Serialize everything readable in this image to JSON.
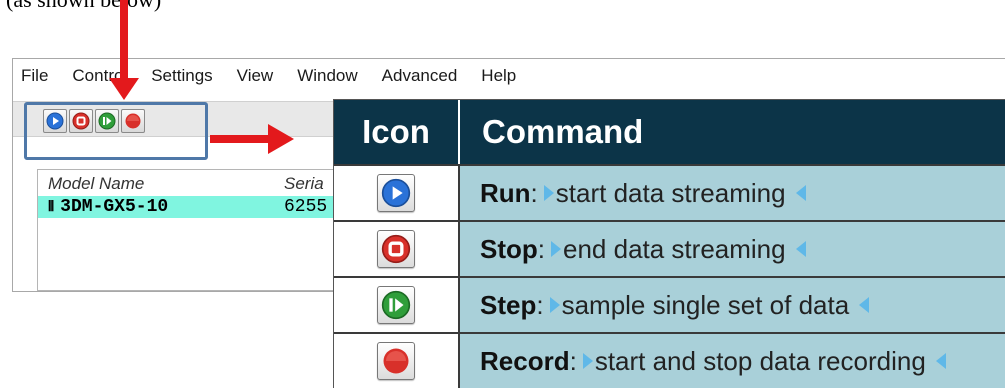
{
  "caption": "(as shown below)",
  "menu": [
    "File",
    "Control",
    "Settings",
    "View",
    "Window",
    "Advanced",
    "Help"
  ],
  "toolbar": {
    "buttons": [
      {
        "name": "run",
        "icon": "play-icon",
        "color": "#2a72d8"
      },
      {
        "name": "stop",
        "icon": "stop-icon",
        "color": "#d8302a"
      },
      {
        "name": "step",
        "icon": "step-icon",
        "color": "#2f9e3a"
      },
      {
        "name": "record",
        "icon": "record-icon",
        "color": "#d8302a"
      }
    ]
  },
  "device_list": {
    "columns": [
      "Model Name",
      "Seria"
    ],
    "rows": [
      {
        "icon": "device-icon",
        "model": "3DM-GX5-10",
        "serial": "6255"
      }
    ],
    "selected_color": "#80f5e0"
  },
  "command_table": {
    "header": {
      "icon": "Icon",
      "command": "Command"
    },
    "header_color": "#0c3448",
    "row_color": "#a9d0d9",
    "rows": [
      {
        "icon": "play-icon",
        "name": "Run",
        "sep": ":",
        "desc": "start data streaming"
      },
      {
        "icon": "stop-icon",
        "name": "Stop",
        "sep": ":",
        "desc": "end data streaming"
      },
      {
        "icon": "step-icon",
        "name": "Step",
        "sep": ":",
        "desc": "sample single set of data"
      },
      {
        "icon": "record-icon",
        "name": "Record",
        "sep": ":",
        "desc": "start and stop data recording"
      }
    ]
  },
  "annotation_color": "#e3191c"
}
